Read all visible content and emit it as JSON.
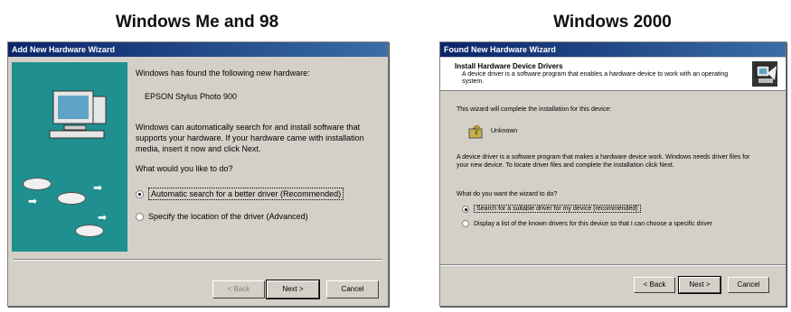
{
  "captions": {
    "left": "Windows Me and 98",
    "right": "Windows 2000"
  },
  "left_dialog": {
    "title": "Add New Hardware Wizard",
    "intro": "Windows has found the following new hardware:",
    "device": "EPSON Stylus Photo 900",
    "body": "Windows can automatically search for and install software that supports your hardware. If your hardware came with installation media, insert it now and click Next.",
    "question": "What would you like to do?",
    "options": [
      {
        "label": "Automatic search for a better driver (Recommended)",
        "checked": true
      },
      {
        "label": "Specify the location of the driver (Advanced)",
        "checked": false
      }
    ],
    "buttons": {
      "back": "< Back",
      "next": "Next >",
      "cancel": "Cancel"
    }
  },
  "right_dialog": {
    "title": "Found New Hardware Wizard",
    "header_title": "Install Hardware Device Drivers",
    "header_sub": "A device driver is a software program that enables a hardware device to work with an operating system.",
    "intro": "This wizard will complete the installation for this device:",
    "device": "Unknown",
    "body": "A device driver is a software program that makes a hardware device work. Windows needs driver files for your new device. To locate driver files and complete the installation click Next.",
    "question": "What do you want the wizard to do?",
    "options": [
      {
        "label": "Search for a suitable driver for my device (recommended)",
        "checked": true
      },
      {
        "label": "Display a list of the known drivers for this device so that I can choose a specific driver",
        "checked": false
      }
    ],
    "buttons": {
      "back": "< Back",
      "next": "Next >",
      "cancel": "Cancel"
    }
  },
  "colors": {
    "titlebar": "#0a246a",
    "dialog_face": "#d4d0c8",
    "wizard_art": "#1f8f8f"
  }
}
